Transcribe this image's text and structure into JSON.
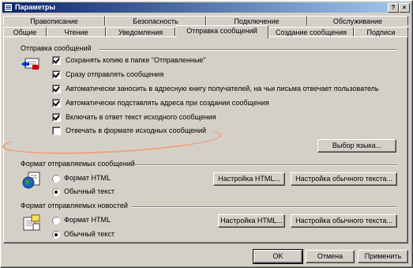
{
  "window": {
    "title": "Параметры",
    "help_button": "?",
    "close_button": "×"
  },
  "tabs_back": [
    "Правописание",
    "Безопасность",
    "Подключение",
    "Обслуживание"
  ],
  "tabs_front": [
    "Общие",
    "Чтение",
    "Уведомления",
    "Отправка сообщений",
    "Создание сообщения",
    "Подписи"
  ],
  "sending": {
    "section_label": "Отправка сообщений",
    "options": [
      {
        "label": "Сохранять копию в папке \"Отправленные\"",
        "checked": true
      },
      {
        "label": "Сразу отправлять сообщения",
        "checked": true
      },
      {
        "label": "Автоматически заносить в адресную книгу получателей, на чьи письма отвечает пользователь",
        "checked": true
      },
      {
        "label": "Автоматически подставлять адреса при создании сообщения",
        "checked": true
      },
      {
        "label": "Включать в ответ текст исходного сообщения",
        "checked": true
      },
      {
        "label": "Отвечать в формате исходных сообщений",
        "checked": false
      }
    ],
    "language_button": "Выбор языка..."
  },
  "mail_format": {
    "section_label": "Формат отправляемых сообщений",
    "radio_html": "Формат HTML",
    "radio_plain": "Обычный текст",
    "selected": "plain",
    "html_settings_button": "Настройка HTML...",
    "plain_settings_button": "Настройка обычного текста..."
  },
  "news_format": {
    "section_label": "Формат отправляемых новостей",
    "radio_html": "Формат HTML",
    "radio_plain": "Обычный текст",
    "selected": "plain",
    "html_settings_button": "Настройка HTML...",
    "plain_settings_button": "Настройка обычного текста..."
  },
  "footer": {
    "ok": "OK",
    "cancel": "Отмена",
    "apply": "Применить"
  },
  "colors": {
    "title_start": "#0a246a",
    "title_end": "#a6caf0",
    "face": "#d4d0c8",
    "annotation": "#f0a07a"
  }
}
